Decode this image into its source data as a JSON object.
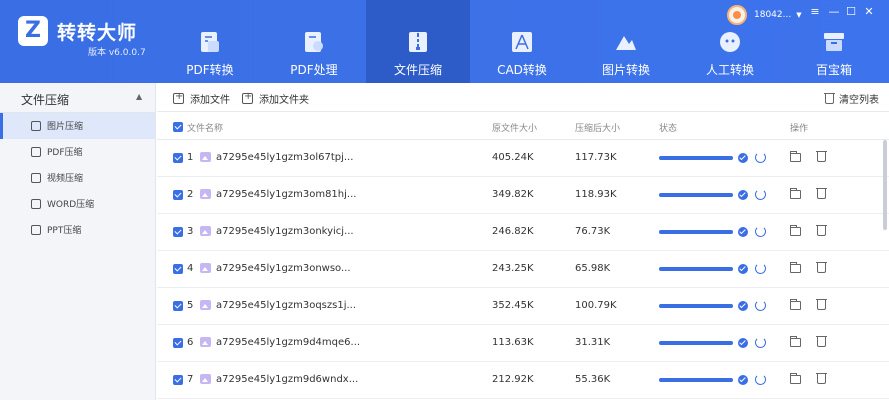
{
  "app": {
    "name": "转转大师",
    "version": "版本 v6.0.0.7",
    "logo_letter": "Z",
    "brand_color": "#3a6ee4"
  },
  "user": {
    "phone": "18042..."
  },
  "nav": {
    "tabs": [
      {
        "label": "PDF转换",
        "icon": "pdf-convert-icon"
      },
      {
        "label": "PDF处理",
        "icon": "pdf-process-icon"
      },
      {
        "label": "文件压缩",
        "icon": "file-compress-icon",
        "active": true
      },
      {
        "label": "CAD转换",
        "icon": "cad-convert-icon"
      },
      {
        "label": "图片转换",
        "icon": "image-convert-icon"
      },
      {
        "label": "人工转换",
        "icon": "manual-convert-icon"
      },
      {
        "label": "百宝箱",
        "icon": "toolbox-icon"
      }
    ]
  },
  "window_controls": {
    "menu": "≡",
    "minimize": "—",
    "maximize": "☐",
    "close": "✕"
  },
  "sidebar": {
    "header": "文件压缩",
    "items": [
      {
        "label": "图片压缩",
        "active": true
      },
      {
        "label": "PDF压缩"
      },
      {
        "label": "视频压缩"
      },
      {
        "label": "WORD压缩"
      },
      {
        "label": "PPT压缩"
      }
    ]
  },
  "toolbar": {
    "add_file": "添加文件",
    "add_folder": "添加文件夹",
    "clear_list": "清空列表"
  },
  "table": {
    "columns": {
      "name": "文件名称",
      "orig_size": "原文件大小",
      "comp_size": "压缩后大小",
      "status": "状态",
      "actions": "操作"
    },
    "rows": [
      {
        "index": "1",
        "name": "a7295e45ly1gzm3ol67tpj...",
        "orig": "405.24K",
        "comp": "117.73K",
        "progress": 1.0
      },
      {
        "index": "2",
        "name": "a7295e45ly1gzm3om81hj...",
        "orig": "349.82K",
        "comp": "118.93K",
        "progress": 1.0
      },
      {
        "index": "3",
        "name": "a7295e45ly1gzm3onkyicj...",
        "orig": "246.82K",
        "comp": "76.73K",
        "progress": 1.0
      },
      {
        "index": "4",
        "name": "a7295e45ly1gzm3onwso...",
        "orig": "243.25K",
        "comp": "65.98K",
        "progress": 1.0
      },
      {
        "index": "5",
        "name": "a7295e45ly1gzm3oqszs1j...",
        "orig": "352.45K",
        "comp": "100.79K",
        "progress": 1.0
      },
      {
        "index": "6",
        "name": "a7295e45ly1gzm9d4mqe6...",
        "orig": "113.63K",
        "comp": "31.31K",
        "progress": 1.0
      },
      {
        "index": "7",
        "name": "a7295e45ly1gzm9d6wndx...",
        "orig": "212.92K",
        "comp": "55.36K",
        "progress": 1.0
      }
    ]
  }
}
